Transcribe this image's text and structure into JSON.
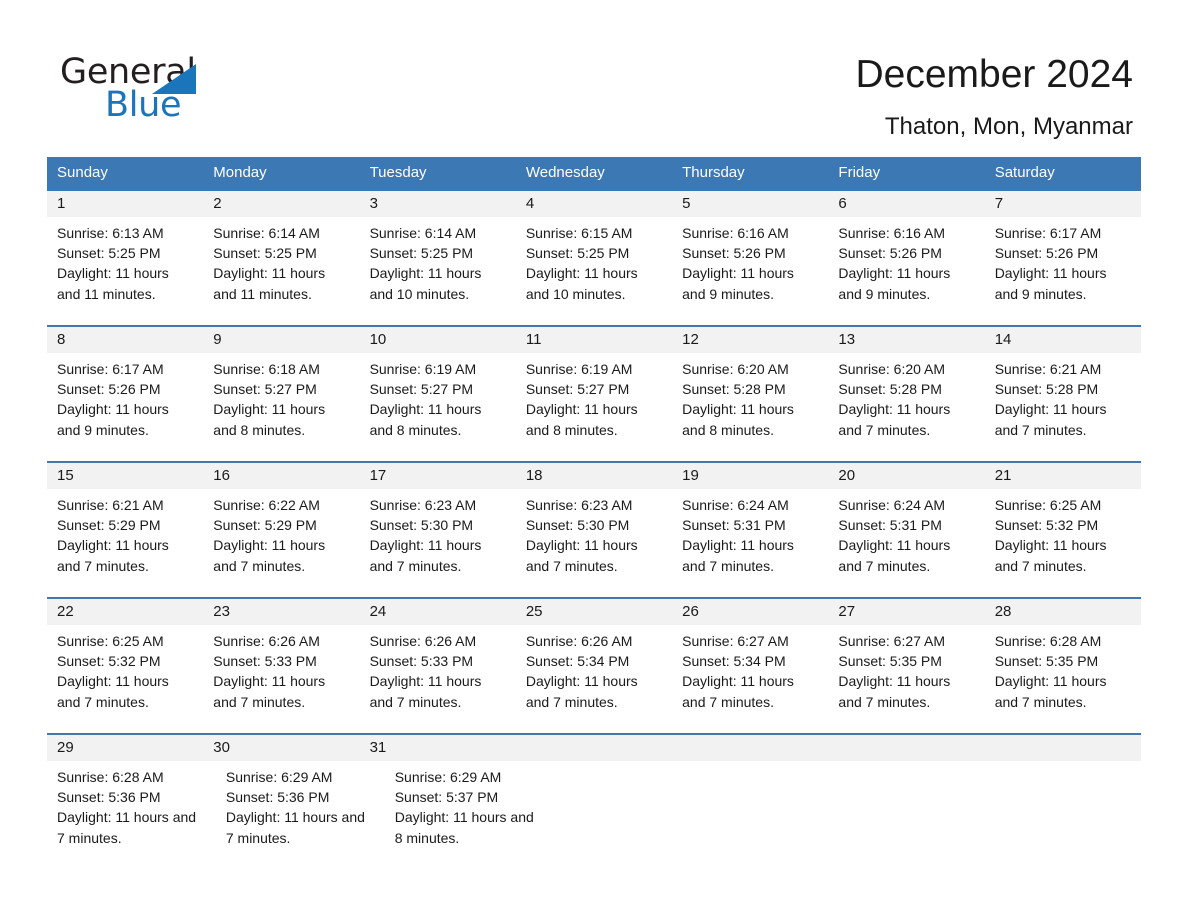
{
  "brand": {
    "name_dark": "General",
    "name_blue": "Blue",
    "triangle_color": "#1b75bb"
  },
  "header": {
    "title": "December 2024",
    "subtitle": "Thaton, Mon, Myanmar",
    "header_bg": "#3b78b4",
    "daynum_bg": "#f2f2f2"
  },
  "weekdays": [
    "Sunday",
    "Monday",
    "Tuesday",
    "Wednesday",
    "Thursday",
    "Friday",
    "Saturday"
  ],
  "weeks": [
    {
      "days": [
        {
          "num": "1",
          "sunrise": "Sunrise: 6:13 AM",
          "sunset": "Sunset: 5:25 PM",
          "daylight": "Daylight: 11 hours and 11 minutes."
        },
        {
          "num": "2",
          "sunrise": "Sunrise: 6:14 AM",
          "sunset": "Sunset: 5:25 PM",
          "daylight": "Daylight: 11 hours and 11 minutes."
        },
        {
          "num": "3",
          "sunrise": "Sunrise: 6:14 AM",
          "sunset": "Sunset: 5:25 PM",
          "daylight": "Daylight: 11 hours and 10 minutes."
        },
        {
          "num": "4",
          "sunrise": "Sunrise: 6:15 AM",
          "sunset": "Sunset: 5:25 PM",
          "daylight": "Daylight: 11 hours and 10 minutes."
        },
        {
          "num": "5",
          "sunrise": "Sunrise: 6:16 AM",
          "sunset": "Sunset: 5:26 PM",
          "daylight": "Daylight: 11 hours and 9 minutes."
        },
        {
          "num": "6",
          "sunrise": "Sunrise: 6:16 AM",
          "sunset": "Sunset: 5:26 PM",
          "daylight": "Daylight: 11 hours and 9 minutes."
        },
        {
          "num": "7",
          "sunrise": "Sunrise: 6:17 AM",
          "sunset": "Sunset: 5:26 PM",
          "daylight": "Daylight: 11 hours and 9 minutes."
        }
      ]
    },
    {
      "days": [
        {
          "num": "8",
          "sunrise": "Sunrise: 6:17 AM",
          "sunset": "Sunset: 5:26 PM",
          "daylight": "Daylight: 11 hours and 9 minutes."
        },
        {
          "num": "9",
          "sunrise": "Sunrise: 6:18 AM",
          "sunset": "Sunset: 5:27 PM",
          "daylight": "Daylight: 11 hours and 8 minutes."
        },
        {
          "num": "10",
          "sunrise": "Sunrise: 6:19 AM",
          "sunset": "Sunset: 5:27 PM",
          "daylight": "Daylight: 11 hours and 8 minutes."
        },
        {
          "num": "11",
          "sunrise": "Sunrise: 6:19 AM",
          "sunset": "Sunset: 5:27 PM",
          "daylight": "Daylight: 11 hours and 8 minutes."
        },
        {
          "num": "12",
          "sunrise": "Sunrise: 6:20 AM",
          "sunset": "Sunset: 5:28 PM",
          "daylight": "Daylight: 11 hours and 8 minutes."
        },
        {
          "num": "13",
          "sunrise": "Sunrise: 6:20 AM",
          "sunset": "Sunset: 5:28 PM",
          "daylight": "Daylight: 11 hours and 7 minutes."
        },
        {
          "num": "14",
          "sunrise": "Sunrise: 6:21 AM",
          "sunset": "Sunset: 5:28 PM",
          "daylight": "Daylight: 11 hours and 7 minutes."
        }
      ]
    },
    {
      "days": [
        {
          "num": "15",
          "sunrise": "Sunrise: 6:21 AM",
          "sunset": "Sunset: 5:29 PM",
          "daylight": "Daylight: 11 hours and 7 minutes."
        },
        {
          "num": "16",
          "sunrise": "Sunrise: 6:22 AM",
          "sunset": "Sunset: 5:29 PM",
          "daylight": "Daylight: 11 hours and 7 minutes."
        },
        {
          "num": "17",
          "sunrise": "Sunrise: 6:23 AM",
          "sunset": "Sunset: 5:30 PM",
          "daylight": "Daylight: 11 hours and 7 minutes."
        },
        {
          "num": "18",
          "sunrise": "Sunrise: 6:23 AM",
          "sunset": "Sunset: 5:30 PM",
          "daylight": "Daylight: 11 hours and 7 minutes."
        },
        {
          "num": "19",
          "sunrise": "Sunrise: 6:24 AM",
          "sunset": "Sunset: 5:31 PM",
          "daylight": "Daylight: 11 hours and 7 minutes."
        },
        {
          "num": "20",
          "sunrise": "Sunrise: 6:24 AM",
          "sunset": "Sunset: 5:31 PM",
          "daylight": "Daylight: 11 hours and 7 minutes."
        },
        {
          "num": "21",
          "sunrise": "Sunrise: 6:25 AM",
          "sunset": "Sunset: 5:32 PM",
          "daylight": "Daylight: 11 hours and 7 minutes."
        }
      ]
    },
    {
      "days": [
        {
          "num": "22",
          "sunrise": "Sunrise: 6:25 AM",
          "sunset": "Sunset: 5:32 PM",
          "daylight": "Daylight: 11 hours and 7 minutes."
        },
        {
          "num": "23",
          "sunrise": "Sunrise: 6:26 AM",
          "sunset": "Sunset: 5:33 PM",
          "daylight": "Daylight: 11 hours and 7 minutes."
        },
        {
          "num": "24",
          "sunrise": "Sunrise: 6:26 AM",
          "sunset": "Sunset: 5:33 PM",
          "daylight": "Daylight: 11 hours and 7 minutes."
        },
        {
          "num": "25",
          "sunrise": "Sunrise: 6:26 AM",
          "sunset": "Sunset: 5:34 PM",
          "daylight": "Daylight: 11 hours and 7 minutes."
        },
        {
          "num": "26",
          "sunrise": "Sunrise: 6:27 AM",
          "sunset": "Sunset: 5:34 PM",
          "daylight": "Daylight: 11 hours and 7 minutes."
        },
        {
          "num": "27",
          "sunrise": "Sunrise: 6:27 AM",
          "sunset": "Sunset: 5:35 PM",
          "daylight": "Daylight: 11 hours and 7 minutes."
        },
        {
          "num": "28",
          "sunrise": "Sunrise: 6:28 AM",
          "sunset": "Sunset: 5:35 PM",
          "daylight": "Daylight: 11 hours and 7 minutes."
        }
      ]
    },
    {
      "days": [
        {
          "num": "29",
          "sunrise": "Sunrise: 6:28 AM",
          "sunset": "Sunset: 5:36 PM",
          "daylight": "Daylight: 11 hours and 7 minutes."
        },
        {
          "num": "30",
          "sunrise": "Sunrise: 6:29 AM",
          "sunset": "Sunset: 5:36 PM",
          "daylight": "Daylight: 11 hours and 7 minutes."
        },
        {
          "num": "31",
          "sunrise": "Sunrise: 6:29 AM",
          "sunset": "Sunset: 5:37 PM",
          "daylight": "Daylight: 11 hours and 8 minutes."
        },
        null,
        null,
        null,
        null
      ]
    }
  ]
}
